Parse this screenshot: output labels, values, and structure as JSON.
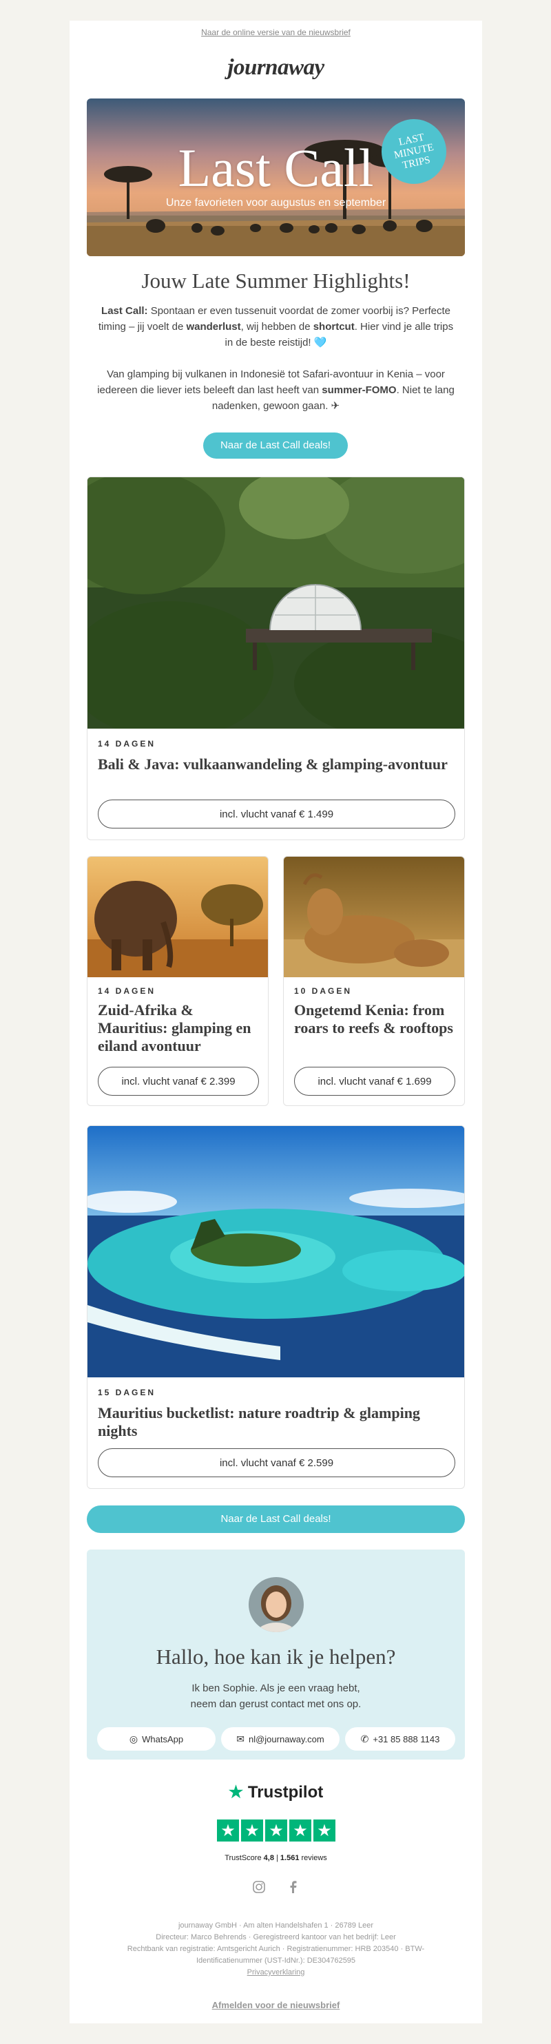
{
  "header": {
    "online_link": "Naar de online versie van de nieuwsbrief",
    "logo": "journaway"
  },
  "hero": {
    "title": "Last Call",
    "subtitle": "Unze favorieten voor augustus en september",
    "badge_line1": "LAST",
    "badge_line2": "MINUTE",
    "badge_line3": "TRIPS"
  },
  "intro": {
    "headline": "Jouw Late Summer Highlights!",
    "p1_bold": "Last Call:",
    "p1_text1": " Spontaan er even tussenuit voordat de zomer voorbij is? Perfecte timing – jij voelt de ",
    "p1_bold2": "wanderlust",
    "p1_text2": ", wij hebben de ",
    "p1_bold3": "shortcut",
    "p1_text3": ". Hier vind je alle trips in de beste reistijd! 🩵",
    "p2_text1": "Van glamping bij vulkanen in Indonesië tot Safari-avontuur in Kenia – voor iedereen die liever iets beleeft dan last heeft van ",
    "p2_bold": "summer-FOMO",
    "p2_text2": ". Niet te lang nadenken, gewoon gaan. ✈",
    "cta": "Naar de Last Call deals!"
  },
  "trips": [
    {
      "days": "14 DAGEN",
      "title": "Bali & Java: vulkaanwandeling & glamping-avontuur",
      "price": "incl. vlucht vanaf € 1.499"
    },
    {
      "days": "14 DAGEN",
      "title": "Zuid-Afrika & Mauritius: glamping en eiland avontuur",
      "price": "incl. vlucht vanaf € 2.399"
    },
    {
      "days": "10 DAGEN",
      "title": "Ongetemd Kenia: from roars to reefs & rooftops",
      "price": "incl. vlucht vanaf € 1.699"
    },
    {
      "days": "15 DAGEN",
      "title": "Mauritius bucketlist: nature roadtrip & glamping nights",
      "price": "incl. vlucht vanaf € 2.599"
    }
  ],
  "cta_bottom": "Naar de Last Call deals!",
  "help": {
    "title": "Hallo, hoe kan ik je helpen?",
    "line1": "Ik ben Sophie. Als je een vraag hebt,",
    "line2": "neem dan gerust contact met ons op.",
    "whatsapp": "WhatsApp",
    "email": "nl@journaway.com",
    "phone": "+31 85 888 1143"
  },
  "trustpilot": {
    "name": "Trustpilot",
    "score_label": "TrustScore",
    "score": "4,8",
    "sep": "|",
    "reviews_count": "1.561",
    "reviews_label": "reviews"
  },
  "footer": {
    "line1": "journaway GmbH · Am alten Handelshafen 1 · 26789 Leer",
    "line2": "Directeur: Marco Behrends · Geregistreerd kantoor van het bedrijf: Leer",
    "line3": "Rechtbank van registratie: Amtsgericht Aurich · Registratienummer: HRB 203540 · BTW-",
    "line4": "Identificatienummer (UST-IdNr.): DE304762595",
    "privacy": "Privacyverklaring",
    "unsubscribe": "Afmelden voor de nieuwsbrief"
  },
  "colors": {
    "accent": "#4fc3cf",
    "help_bg": "#dcf0f3",
    "trustpilot_green": "#00b67a"
  }
}
